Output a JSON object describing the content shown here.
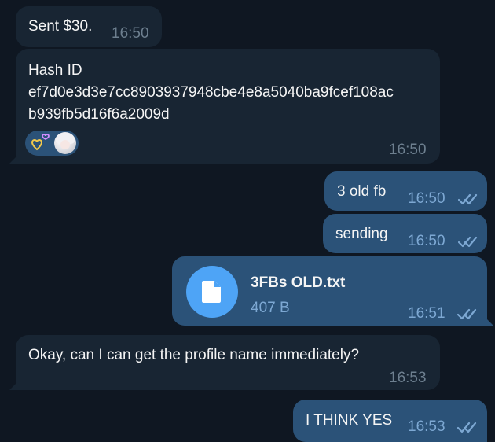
{
  "messages": [
    {
      "id": "m1",
      "direction": "incoming",
      "text": "Sent $30.",
      "time": "16:50"
    },
    {
      "id": "m2",
      "direction": "incoming",
      "lines": [
        "Hash ID",
        "ef7d0e3d3e7cc8903937948cbe4e8a5040ba9fcef108ac",
        "b939fb5d16f6a2009d"
      ],
      "time": "16:50",
      "reaction": {
        "emoji": "heart",
        "reactor": "user-avatar"
      }
    },
    {
      "id": "m3",
      "direction": "outgoing",
      "text": "3 old fb",
      "time": "16:50",
      "status": "read"
    },
    {
      "id": "m4",
      "direction": "outgoing",
      "text": "sending",
      "time": "16:50",
      "status": "read"
    },
    {
      "id": "m5",
      "direction": "outgoing",
      "file": {
        "name": "3FBs OLD.txt",
        "size": "407 B",
        "icon": "document-icon"
      },
      "time": "16:51",
      "status": "read"
    },
    {
      "id": "m6",
      "direction": "incoming",
      "text": "Okay, can I can get the profile name immediately?",
      "time": "16:53"
    },
    {
      "id": "m7",
      "direction": "outgoing",
      "text": "I THINK YES",
      "time": "16:53",
      "status": "read"
    }
  ],
  "colors": {
    "background": "#0f1722",
    "incoming_bubble": "#182533",
    "outgoing_bubble": "#2b5278",
    "text": "#f5f5f5",
    "incoming_time": "#6d7f8f",
    "outgoing_time": "#7da8d3",
    "file_icon_bg": "#4ea4f6"
  }
}
